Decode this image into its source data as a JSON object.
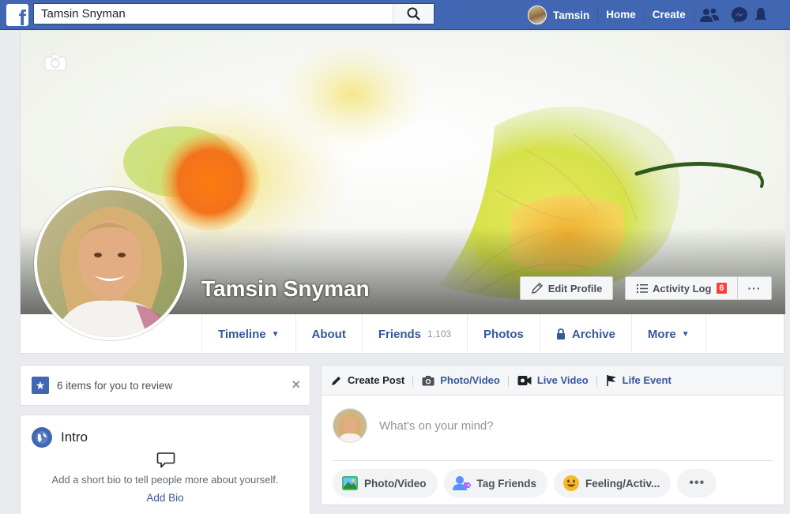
{
  "topbar": {
    "logo_letter": "f",
    "search_value": "Tamsin Snyman",
    "user_name": "Tamsin",
    "home_label": "Home",
    "create_label": "Create"
  },
  "profile": {
    "name": "Tamsin Snyman",
    "edit_profile_label": "Edit Profile",
    "activity_log_label": "Activity Log",
    "activity_log_count": "6",
    "more_dots": "···"
  },
  "tabs": [
    {
      "label": "Timeline",
      "caret": "▼"
    },
    {
      "label": "About"
    },
    {
      "label": "Friends",
      "count": "1,103"
    },
    {
      "label": "Photos"
    },
    {
      "label": "Archive"
    },
    {
      "label": "More",
      "caret": "▼"
    }
  ],
  "review": {
    "text": "6 items for you to review",
    "close": "×"
  },
  "intro": {
    "title": "Intro",
    "text": "Add a short bio to tell people more about yourself.",
    "add_bio": "Add Bio"
  },
  "composer": {
    "tabs": [
      "Create Post",
      "Photo/Video",
      "Live Video",
      "Life Event"
    ],
    "placeholder": "What's on your mind?",
    "actions": [
      "Photo/Video",
      "Tag Friends",
      "Feeling/Activ..."
    ],
    "more_dots": "•••"
  },
  "colors": {
    "brand_blue": "#4267b2",
    "link_blue": "#365899",
    "badge_red": "#fa3e3e",
    "background": "#e9ebee"
  }
}
